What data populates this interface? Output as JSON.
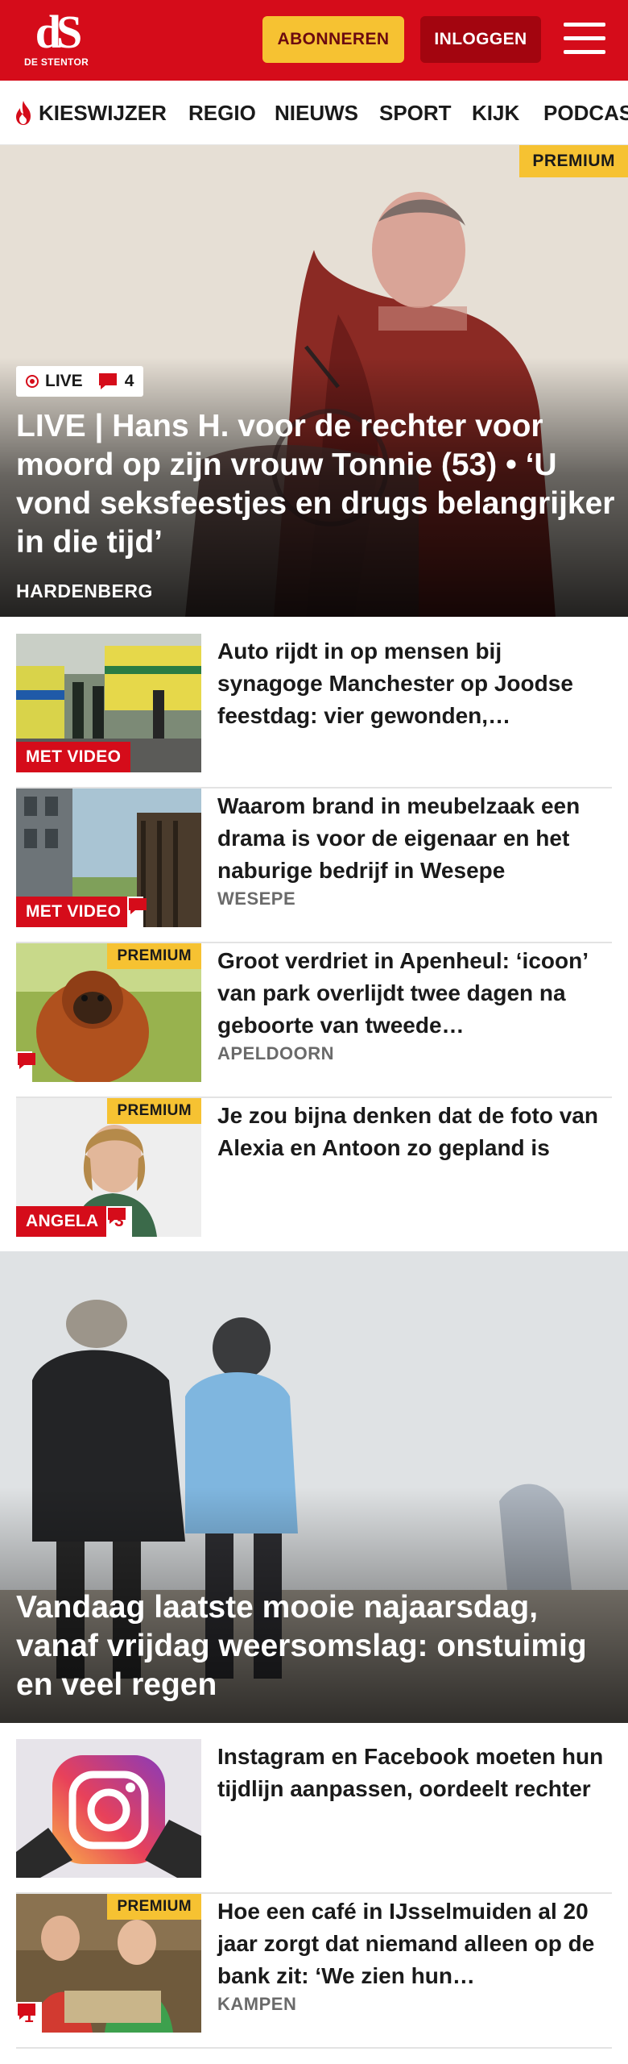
{
  "header": {
    "logo_mark": "dS",
    "logo_text": "DE STENTOR",
    "subscribe_label": "ABONNEREN",
    "login_label": "INLOGGEN",
    "menu_icon": "hamburger-menu-icon",
    "brand_color": "#d50c1a",
    "subscribe_color": "#f6c232"
  },
  "nav": {
    "items": [
      {
        "label": "KIESWIJZER",
        "icon": "flame-icon"
      },
      {
        "label": "REGIO"
      },
      {
        "label": "NIEUWS"
      },
      {
        "label": "SPORT"
      },
      {
        "label": "KIJK"
      },
      {
        "label": "PODCAS"
      }
    ]
  },
  "hero": {
    "premium_label": "PREMIUM",
    "live_label": "LIVE",
    "comment_count": "4",
    "title": "LIVE | Hans H. voor de rechter voor moord op zijn vrouw Tonnie (53) • ‘U vond seksfeestjes en drugs belangrij­ker in die tijd’",
    "location": "HARDENBERG"
  },
  "articles": [
    {
      "title": "Auto rijdt in op mensen bij synagoge Manchester op Joodse feestdag: vier gewonden,…",
      "label": "MET VIDEO"
    },
    {
      "title": "Waarom brand in meubelzaak een drama is voor de eigenaar en het naburige bedrijf in Wesepe",
      "label": "MET VIDEO",
      "location": "WESEPE"
    },
    {
      "title": "Groot verdriet in Apenheul: ‘icoon’ van park overlijdt twee dagen na geboorte van tweede…",
      "premium_label": "PREMIUM",
      "location": "APELDOORN"
    },
    {
      "title": "Je zou bijna denken dat de foto van Alexia en Antoon zo gepland is",
      "premium_label": "PREMIUM",
      "label": "ANGELA",
      "comment_count": "3"
    }
  ],
  "hero2": {
    "title": "Vandaag laatste mooie najaarsdag, vanaf vrijdag weersomslag: onstuimig en veel regen"
  },
  "articles2": [
    {
      "title": "Instagram en Facebook moeten hun tijdlijn aanpassen, oordeelt rechter"
    },
    {
      "title": "Hoe een café in IJsselmuiden al 20 jaar zorgt dat niemand alleen op de bank zit: ‘We zien hun…",
      "premium_label": "PREMIUM",
      "comment_count": "1",
      "location": "KAMPEN"
    }
  ]
}
